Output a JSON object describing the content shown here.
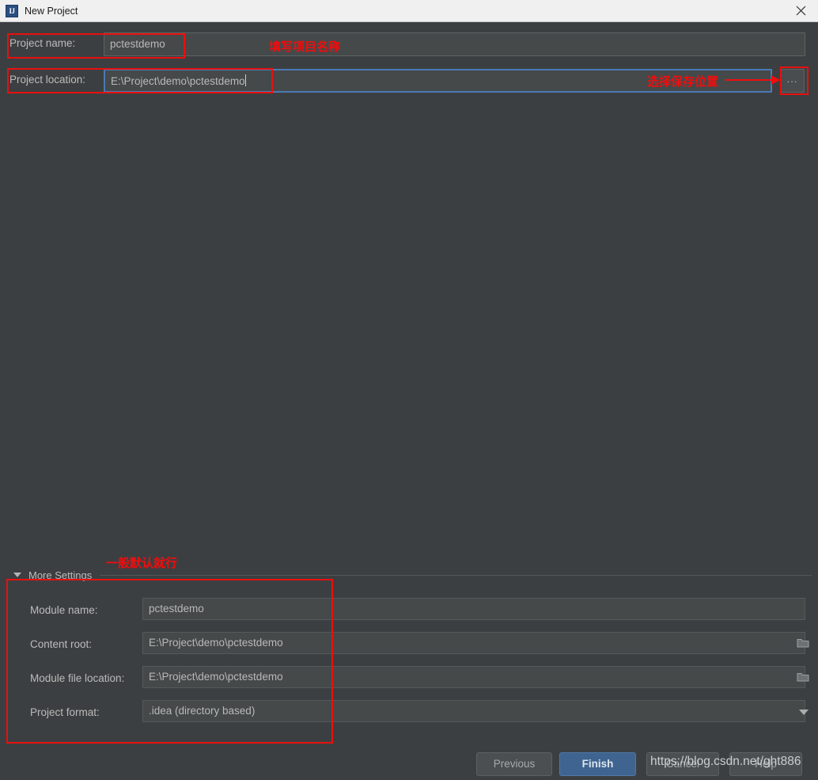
{
  "window": {
    "title": "New Project",
    "icon": "IJ",
    "close_icon": "close-icon"
  },
  "form": {
    "project_name": {
      "label": "Project name:",
      "value": "pctestdemo"
    },
    "project_location": {
      "label": "Project location:",
      "value": "E:\\Project\\demo\\pctestdemo",
      "browse_label": "..."
    }
  },
  "more_settings": {
    "header": "More Settings",
    "expanded": true,
    "rows": [
      {
        "label": "Module name:",
        "value": "pctestdemo",
        "trailing": "none"
      },
      {
        "label": "Content root:",
        "value": "E:\\Project\\demo\\pctestdemo",
        "trailing": "folder-icon"
      },
      {
        "label": "Module file location:",
        "value": "E:\\Project\\demo\\pctestdemo",
        "trailing": "folder-icon"
      },
      {
        "label": "Project format:",
        "value": ".idea (directory based)",
        "trailing": "chevron-down-icon"
      }
    ]
  },
  "footer": {
    "previous": "Previous",
    "finish": "Finish",
    "cancel": "Cancel",
    "help": "Help"
  },
  "annotations": {
    "name_note": "填写项目名称",
    "location_note": "选择保存位置",
    "more_settings_note": "一般默认就行",
    "color": "#f10d0d"
  },
  "watermark": "https://blog.csdn.net/ght886",
  "colors": {
    "dialog_bg": "#3c3f41",
    "field_bg": "#45494a",
    "titlebar_bg": "#f0f0f0",
    "focus_border": "#4a7ab5",
    "primary_button": "#3f648f",
    "annotation_red": "#e8100f"
  }
}
